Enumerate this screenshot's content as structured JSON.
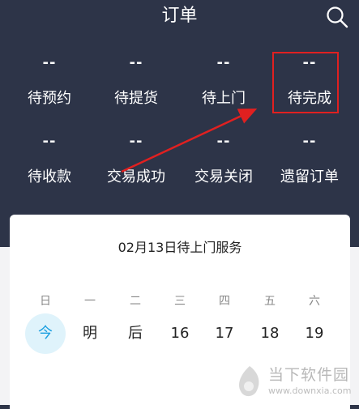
{
  "header": {
    "title": "订单",
    "search_icon": "search-icon"
  },
  "status_grid": [
    {
      "count": "--",
      "label": "待预约"
    },
    {
      "count": "--",
      "label": "待提货"
    },
    {
      "count": "--",
      "label": "待上门"
    },
    {
      "count": "--",
      "label": "待完成"
    },
    {
      "count": "--",
      "label": "待收款"
    },
    {
      "count": "--",
      "label": "交易成功"
    },
    {
      "count": "--",
      "label": "交易关闭"
    },
    {
      "count": "--",
      "label": "遗留订单"
    }
  ],
  "annotation": {
    "highlight_color": "#e02020",
    "arrow_color": "#e02020"
  },
  "calendar_card": {
    "title": "02月13日待上门服务",
    "weekdays": [
      "日",
      "一",
      "二",
      "三",
      "四",
      "五",
      "六"
    ],
    "dates": [
      "今",
      "明",
      "后",
      "16",
      "17",
      "18",
      "19"
    ],
    "today_color": "#1a9fe0"
  },
  "watermark": {
    "text": "当下软件园",
    "url": "www.downxia.com"
  },
  "colors": {
    "header_bg": "#2d3448",
    "card_bg": "#ffffff"
  }
}
